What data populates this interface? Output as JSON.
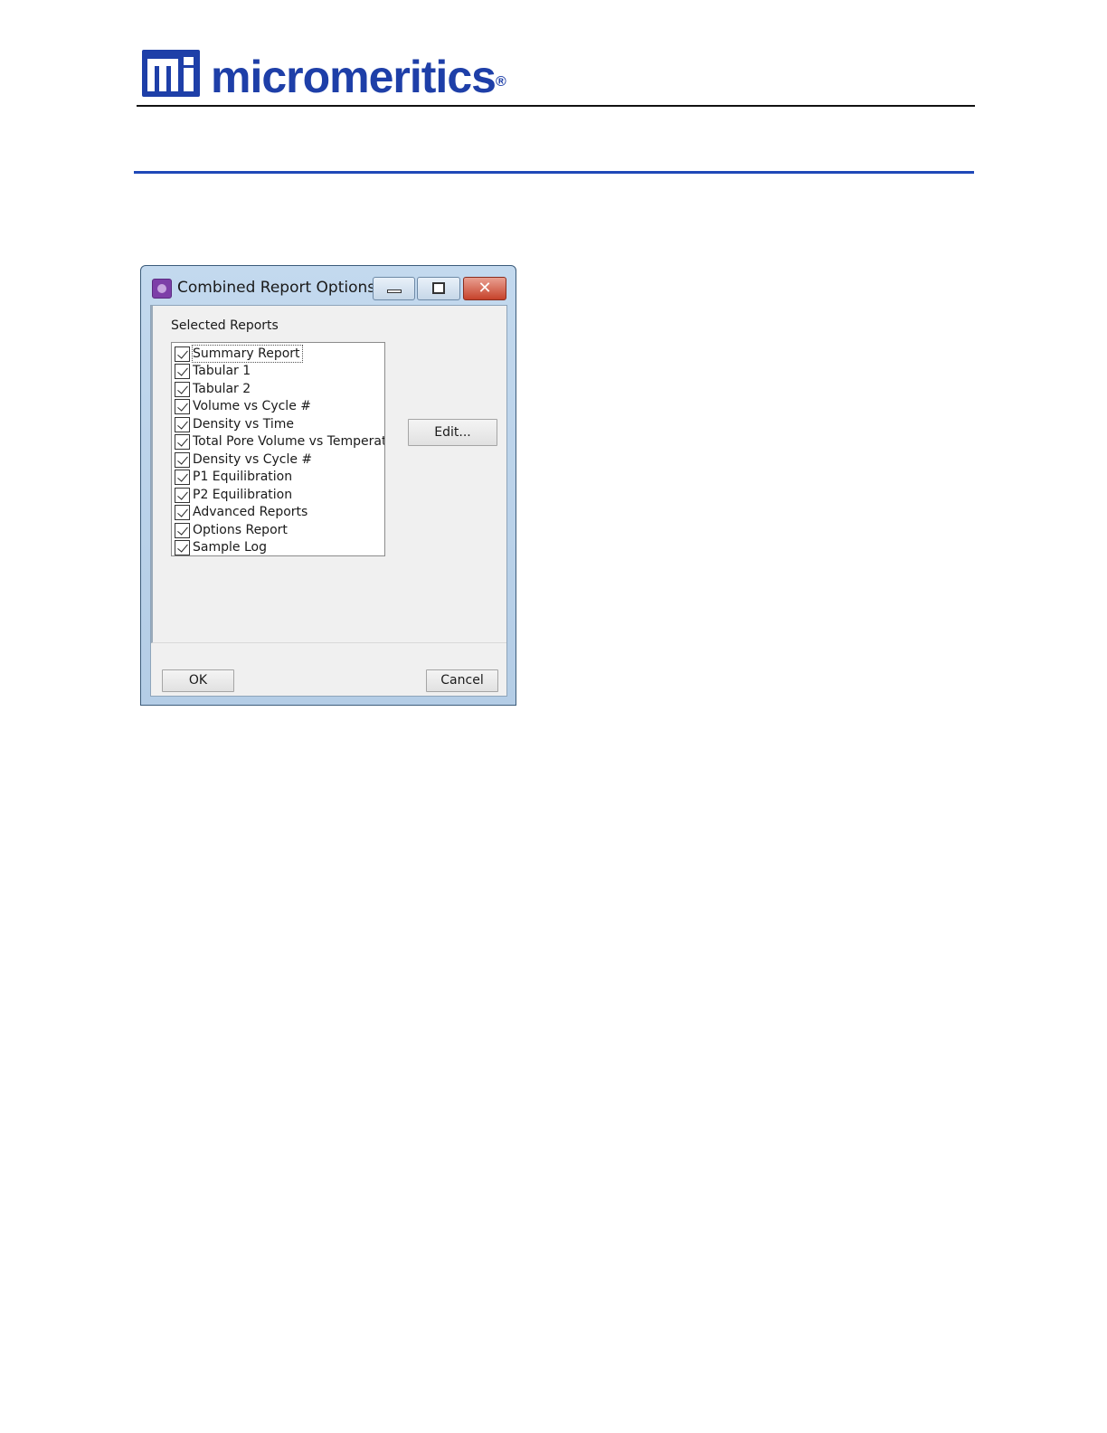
{
  "header": {
    "brand": "micromeritics",
    "brand_reg": "®"
  },
  "dialog": {
    "title": "Combined Report Options",
    "controls": {
      "close_glyph": "✕"
    },
    "group_label": "Selected Reports",
    "reports": [
      {
        "label": "Summary Report",
        "checked": true,
        "focused": true
      },
      {
        "label": "Tabular 1",
        "checked": true
      },
      {
        "label": "Tabular 2",
        "checked": true
      },
      {
        "label": "Volume vs Cycle #",
        "checked": true
      },
      {
        "label": "Density vs Time",
        "checked": true
      },
      {
        "label": "Total Pore Volume vs Temperatu",
        "checked": true
      },
      {
        "label": "Density vs Cycle #",
        "checked": true
      },
      {
        "label": "P1 Equilibration",
        "checked": true
      },
      {
        "label": "P2 Equilibration",
        "checked": true
      },
      {
        "label": "Advanced Reports",
        "checked": true
      },
      {
        "label": "Options Report",
        "checked": true
      },
      {
        "label": "Sample Log",
        "checked": true
      }
    ],
    "edit_label": "Edit...",
    "ok_label": "OK",
    "cancel_label": "Cancel"
  },
  "colors": {
    "brand_blue": "#1e3fa8",
    "section_rule": "#1f48b8",
    "close_button": "#c6422b",
    "app_icon": "#7d3fa8"
  },
  "icons": {
    "logo": "micromeritics-mi-logo",
    "app": "app-icon",
    "minimize": "minimize-icon",
    "maximize": "maximize-icon",
    "close": "close-icon",
    "checkbox": "checkbox-checked-icon"
  }
}
